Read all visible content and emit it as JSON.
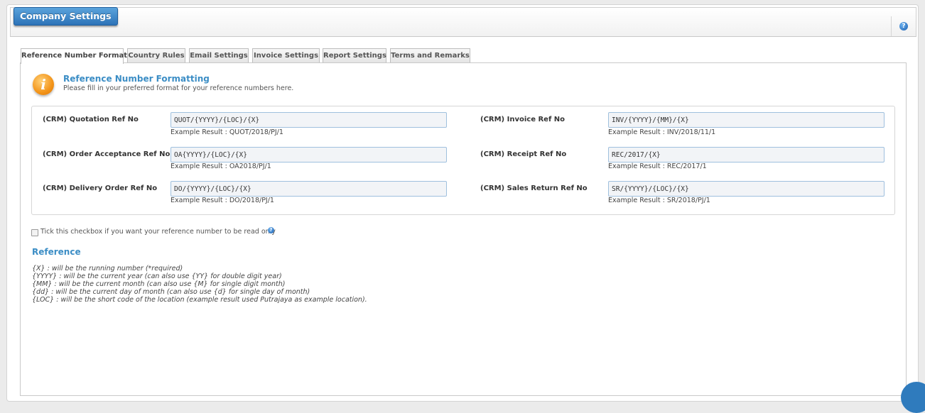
{
  "page": {
    "title": "Company Settings",
    "help_glyph": "?"
  },
  "tabs": [
    {
      "label": "Reference Number Format",
      "active": true
    },
    {
      "label": "Country Rules",
      "active": false
    },
    {
      "label": "Email Settings",
      "active": false
    },
    {
      "label": "Invoice Settings",
      "active": false
    },
    {
      "label": "Report Settings",
      "active": false
    },
    {
      "label": "Terms and Remarks",
      "active": false
    }
  ],
  "section": {
    "icon_glyph": "i",
    "title": "Reference Number Formatting",
    "subtitle": "Please fill in your preferred format for your reference numbers here."
  },
  "fields": [
    {
      "label": "(CRM) Quotation Ref No",
      "value": "QUOT/{YYYY}/{LOC}/{X}",
      "example": "Example Result : QUOT/2018/PJ/1"
    },
    {
      "label": "(CRM) Invoice Ref No",
      "value": "INV/{YYYY}/{MM}/{X}",
      "example": "Example Result : INV/2018/11/1"
    },
    {
      "label": "(CRM) Order Acceptance Ref No",
      "value": "OA{YYYY}/{LOC}/{X}",
      "example": "Example Result : OA2018/PJ/1"
    },
    {
      "label": "(CRM) Receipt Ref No",
      "value": "REC/2017/{X}",
      "example": "Example Result : REC/2017/1"
    },
    {
      "label": "(CRM) Delivery Order Ref No",
      "value": "DO/{YYYY}/{LOC}/{X}",
      "example": "Example Result : DO/2018/PJ/1"
    },
    {
      "label": "(CRM) Sales Return Ref No",
      "value": "SR/{YYYY}/{LOC}/{X}",
      "example": "Example Result : SR/2018/PJ/1"
    }
  ],
  "readonly": {
    "checked": false,
    "label": "Tick this checkbox if you want your reference number to be read only",
    "help_glyph": "?"
  },
  "reference": {
    "title": "Reference",
    "lines": [
      "{X} : will be the running number (*required)",
      "{YYYY} : will be the current year (can also use {YY} for double digit year)",
      "{MM} : will be the current month (can also use {M} for single digit month)",
      "{dd} : will be the current day of month (can also use {d} for single day of month)",
      "{LOC} : will be the short code of the location (example result used Putrajaya as example location)."
    ]
  },
  "colors": {
    "accent": "#3b8dc5",
    "title_button": "#2d73b8",
    "info_icon": "#f39419"
  }
}
